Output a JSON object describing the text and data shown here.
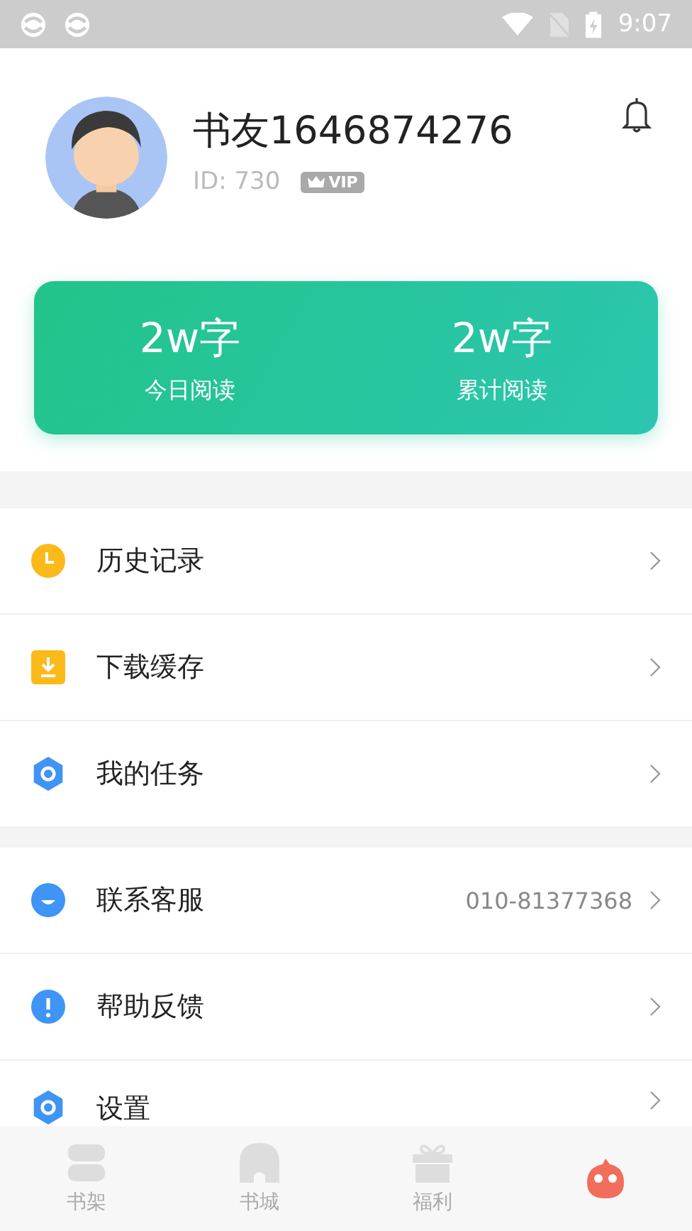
{
  "status_bar": {
    "time": "9:07"
  },
  "profile": {
    "name": "书友1646874276",
    "id": "ID: 730",
    "badge": "VIP"
  },
  "stats": [
    {
      "value": "2w字",
      "label": "今日阅读"
    },
    {
      "value": "2w字",
      "label": "累计阅读"
    }
  ],
  "menu_groups": [
    [
      {
        "label": "历史记录"
      },
      {
        "label": "下载缓存"
      },
      {
        "label": "我的任务"
      }
    ],
    [
      {
        "label": "联系客服",
        "value": "010-81377368"
      },
      {
        "label": "帮助反馈"
      },
      {
        "label": "设置"
      }
    ]
  ],
  "tabs": [
    {
      "label": "书架",
      "selected": false
    },
    {
      "label": "书城",
      "selected": false
    },
    {
      "label": "福利",
      "selected": false
    },
    {
      "selected": true
    }
  ]
}
